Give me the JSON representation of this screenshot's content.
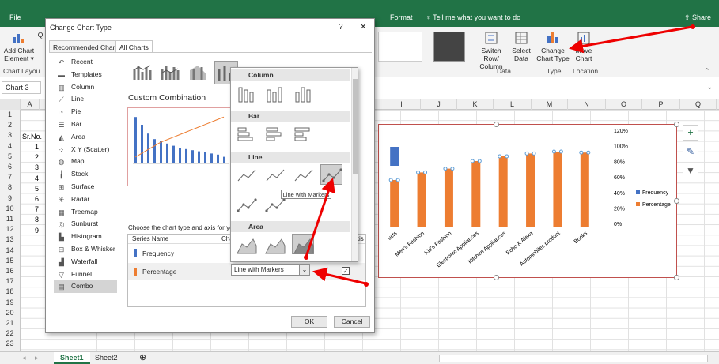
{
  "ribbon_tabs": {
    "file": "File",
    "format": "Format",
    "tell_me": "Tell me what you want to do",
    "share": "Share"
  },
  "ribbon": {
    "add_chart_element": [
      "Add Chart",
      "Element ▾"
    ],
    "quick_layout": "Q",
    "chart_layouts_group": "Chart Layou",
    "switch_row_col": [
      "Switch Row/",
      "Column"
    ],
    "select_data": [
      "Select",
      "Data"
    ],
    "change_chart_type": [
      "Change",
      "Chart Type"
    ],
    "move_chart": [
      "Move",
      "Chart"
    ],
    "groups": {
      "data": "Data",
      "type": "Type",
      "location": "Location"
    }
  },
  "name_box": "Chart 3",
  "columns": [
    "A",
    "I",
    "J",
    "K",
    "L",
    "M",
    "N",
    "O",
    "P",
    "Q"
  ],
  "rows": [
    "1",
    "2",
    "3",
    "4",
    "5",
    "6",
    "7",
    "8",
    "9",
    "10",
    "11",
    "12",
    "13",
    "14",
    "15",
    "16",
    "17",
    "18",
    "19",
    "20",
    "21",
    "22",
    "23"
  ],
  "cells": {
    "header": "Sr.No.",
    "values": [
      "1",
      "2",
      "3",
      "4",
      "5",
      "6",
      "7",
      "8",
      "9"
    ]
  },
  "chart": {
    "categories": [
      "ucts",
      "Men's Fashion",
      "Kid's Fashion",
      "Electronic Appliances",
      "Kitchen Appliances",
      "Echo & Alexa",
      "Automobiles product",
      "Books"
    ],
    "percentage": [
      0.5,
      0.58,
      0.62,
      0.7,
      0.75,
      0.78,
      0.8,
      0.79
    ],
    "frequency": [
      0.62
    ],
    "axis_ticks": [
      "120%",
      "100%",
      "80%",
      "60%",
      "40%",
      "20%",
      "0%"
    ],
    "legend": [
      "Frequency",
      "Percentage"
    ],
    "colors": {
      "frequency": "#4472c4",
      "percentage": "#ed7d31"
    }
  },
  "sheets": [
    "Sheet1",
    "Sheet2"
  ],
  "dialog": {
    "title": "Change Chart Type",
    "help": "?",
    "close": "✕",
    "tabs": [
      "Recommended Charts",
      "All Charts"
    ],
    "categories": [
      {
        "label": "Recent",
        "icon": "↶"
      },
      {
        "label": "Templates",
        "icon": "▬"
      },
      {
        "label": "Column",
        "icon": "▥"
      },
      {
        "label": "Line",
        "icon": "⟋"
      },
      {
        "label": "Pie",
        "icon": "◔"
      },
      {
        "label": "Bar",
        "icon": "☰"
      },
      {
        "label": "Area",
        "icon": "◭"
      },
      {
        "label": "X Y (Scatter)",
        "icon": "⁘"
      },
      {
        "label": "Map",
        "icon": "◍"
      },
      {
        "label": "Stock",
        "icon": "╽"
      },
      {
        "label": "Surface",
        "icon": "⊞"
      },
      {
        "label": "Radar",
        "icon": "✳"
      },
      {
        "label": "Treemap",
        "icon": "▦"
      },
      {
        "label": "Sunburst",
        "icon": "◎"
      },
      {
        "label": "Histogram",
        "icon": "▙"
      },
      {
        "label": "Box & Whisker",
        "icon": "⊟"
      },
      {
        "label": "Waterfall",
        "icon": "▟"
      },
      {
        "label": "Funnel",
        "icon": "▽"
      },
      {
        "label": "Combo",
        "icon": "▤"
      }
    ],
    "preview_title": "Custom Combination",
    "choose_label": "Choose the chart type and axis for you",
    "series_header": [
      "Series Name",
      "Cha",
      "xis"
    ],
    "series": [
      {
        "name": "Frequency",
        "color": "#4472c4"
      },
      {
        "name": "Percentage",
        "color": "#ed7d31"
      }
    ],
    "ok": "OK",
    "cancel": "Cancel"
  },
  "gallery": {
    "sections": [
      "Column",
      "Bar",
      "Line",
      "Area"
    ],
    "tooltip": "Line with Markers",
    "selected": "Line with Markers"
  }
}
